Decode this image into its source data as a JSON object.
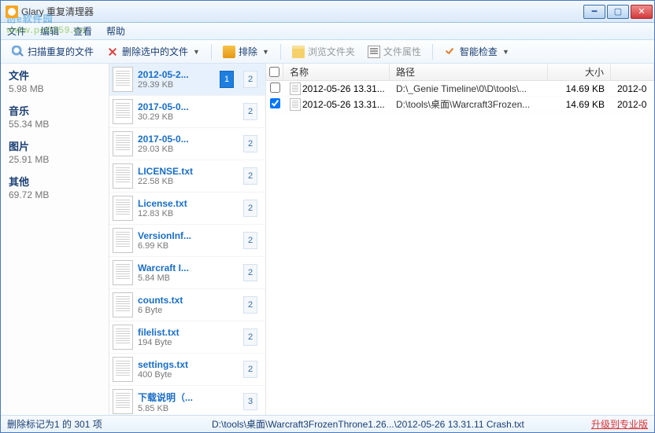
{
  "window": {
    "title": "Glary 重复清理器"
  },
  "watermark": {
    "main": "创e软件园",
    "sub": "www.pc0359.cn"
  },
  "menu": {
    "file": "文件",
    "edit": "编辑",
    "view": "查看",
    "help": "帮助"
  },
  "toolbar": {
    "scan": "扫描重复的文件",
    "delete_selected": "删除选中的文件",
    "sort": "排除",
    "browse_folder": "浏览文件夹",
    "file_props": "文件属性",
    "smart_check": "智能检查"
  },
  "categories": [
    {
      "label": "文件",
      "size": "5.98 MB"
    },
    {
      "label": "音乐",
      "size": "55.34 MB"
    },
    {
      "label": "图片",
      "size": "25.91 MB"
    },
    {
      "label": "其他",
      "size": "69.72 MB"
    }
  ],
  "groups": [
    {
      "name": "2012-05-2...",
      "size": "29.39 KB",
      "count1": "1",
      "count2": "2",
      "selected": true
    },
    {
      "name": "2017-05-0...",
      "size": "30.29 KB",
      "count2": "2"
    },
    {
      "name": "2017-05-0...",
      "size": "29.03 KB",
      "count2": "2"
    },
    {
      "name": "LICENSE.txt",
      "size": "22.58 KB",
      "count2": "2"
    },
    {
      "name": "License.txt",
      "size": "12.83 KB",
      "count2": "2"
    },
    {
      "name": "VersionInf...",
      "size": "6.99 KB",
      "count2": "2"
    },
    {
      "name": "Warcraft I...",
      "size": "5.84 MB",
      "count2": "2"
    },
    {
      "name": "counts.txt",
      "size": "6 Byte",
      "count2": "2"
    },
    {
      "name": "filelist.txt",
      "size": "194 Byte",
      "count2": "2"
    },
    {
      "name": "settings.txt",
      "size": "400 Byte",
      "count2": "2"
    },
    {
      "name": "下载说明（...",
      "size": "5.85 KB",
      "count2": "3"
    }
  ],
  "detail": {
    "cols": {
      "name": "名称",
      "path": "路径",
      "size": "大小",
      "date": ""
    },
    "rows": [
      {
        "checked": false,
        "name": "2012-05-26 13.31...",
        "path": "D:\\_Genie Timeline\\0\\D\\tools\\...",
        "size": "14.69 KB",
        "date": "2012-0"
      },
      {
        "checked": true,
        "name": "2012-05-26 13.31...",
        "path": "D:\\tools\\桌面\\Warcraft3Frozen...",
        "size": "14.69 KB",
        "date": "2012-0"
      }
    ]
  },
  "status": {
    "left": "删除标记为1 的 301 项",
    "mid": "D:\\tools\\桌面\\Warcraft3FrozenThrone1.26...\\2012-05-26 13.31.11 Crash.txt",
    "right": "升级到专业版"
  }
}
